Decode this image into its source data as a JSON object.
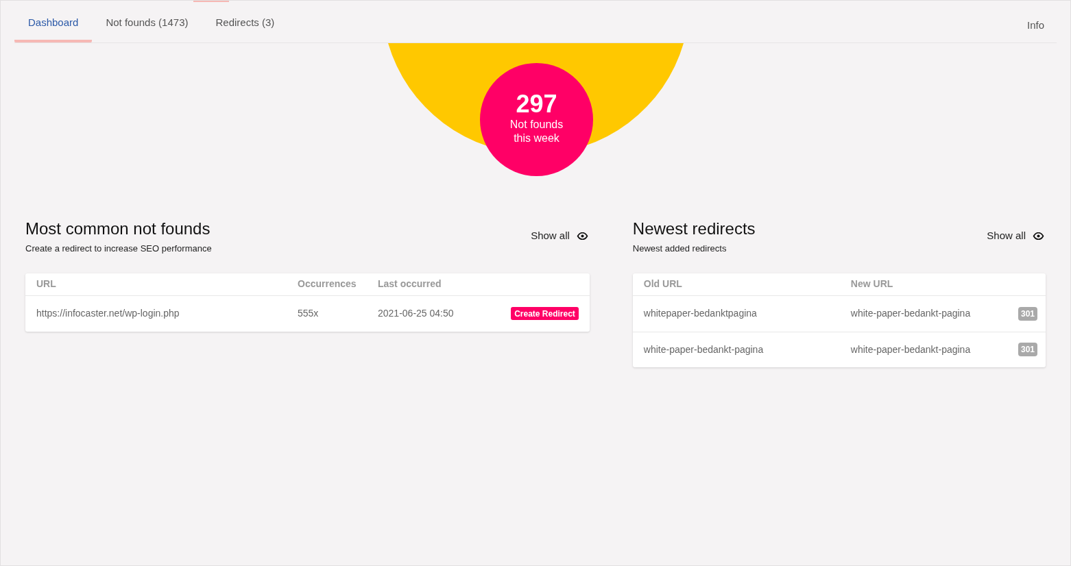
{
  "tabs": [
    {
      "label": "Dashboard",
      "selected": true
    },
    {
      "label": "Not founds (1473)",
      "selected": false
    },
    {
      "label": "Redirects (3)",
      "selected": false
    }
  ],
  "info_link": "Info",
  "stat": {
    "value": "297",
    "label_line1": "Not founds",
    "label_line2": "this week"
  },
  "not_founds": {
    "title": "Most common not founds",
    "subtitle": "Create a redirect to increase SEO performance",
    "show_all": "Show all",
    "columns": [
      "URL",
      "Occurrences",
      "Last occurred"
    ],
    "rows": [
      {
        "url": "https://infocaster.net/wp-login.php",
        "occurrences": "555x",
        "last": "2021-06-25 04:50",
        "action": "Create Redirect"
      }
    ]
  },
  "redirects": {
    "title": "Newest redirects",
    "subtitle": "Newest added redirects",
    "show_all": "Show all",
    "columns": [
      "Old URL",
      "New URL"
    ],
    "rows": [
      {
        "old": "whitepaper-bedanktpagina",
        "new": "white-paper-bedankt-pagina",
        "code": "301"
      },
      {
        "old": "white-paper-bedankt-pagina",
        "new": "white-paper-bedankt-pagina",
        "code": "301"
      }
    ]
  }
}
